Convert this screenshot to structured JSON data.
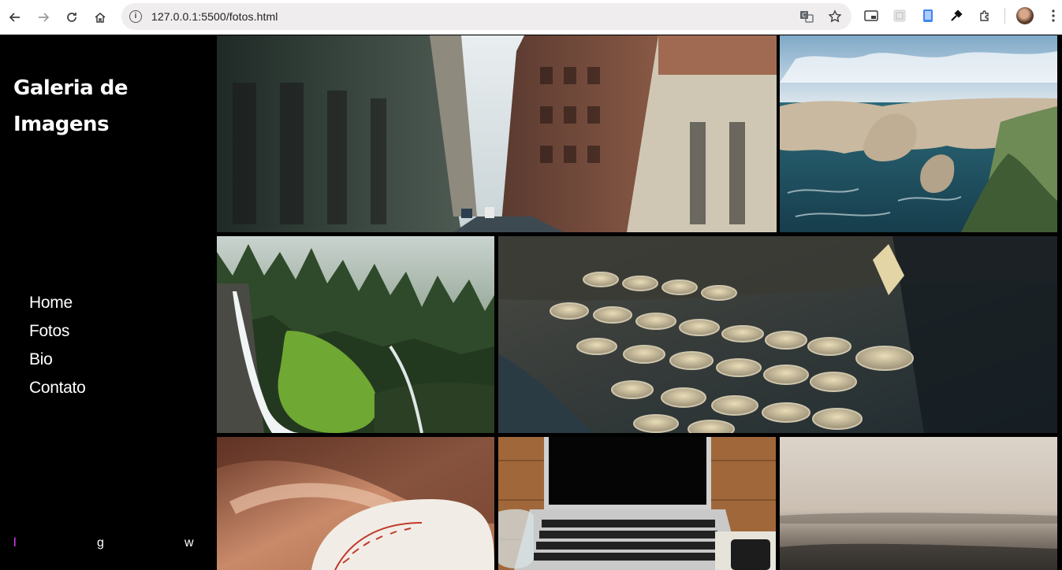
{
  "browser": {
    "url": "127.0.0.1:5500/fotos.html",
    "icons": [
      "back-icon",
      "forward-icon",
      "reload-icon",
      "home-icon",
      "site-info-icon",
      "translate-icon",
      "bookmark-star-icon",
      "picture-in-picture-icon",
      "extension-icon",
      "extension-icon",
      "eyedropper-icon",
      "extensions-puzzle-icon",
      "profile-avatar",
      "more-menu-icon"
    ]
  },
  "sidebar": {
    "title": "Galeria de Imagens",
    "menu": [
      "Home",
      "Fotos",
      "Bio",
      "Contato"
    ],
    "social": [
      "l",
      "g",
      "w"
    ],
    "social_colors": [
      "#e040fb",
      "#ffffff",
      "#ffffff"
    ]
  },
  "gallery": {
    "photos": [
      "city-street-photo",
      "ocean-cliffs-photo",
      "waterfall-forest-photo",
      "typewriter-photo",
      "baseball-glove-photo",
      "laptop-desk-photo",
      "foggy-sea-photo"
    ]
  }
}
